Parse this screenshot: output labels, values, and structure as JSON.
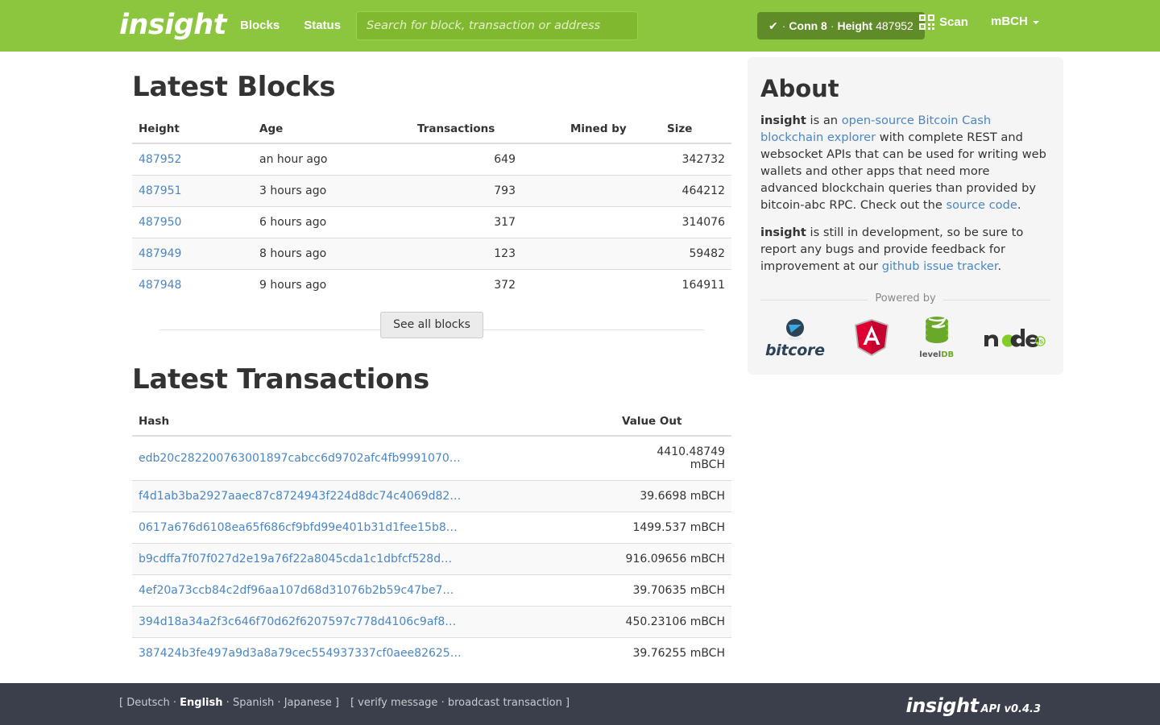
{
  "navbar": {
    "brand": "insight",
    "links": [
      {
        "label": "Blocks",
        "name": "nav-link-blocks"
      },
      {
        "label": "Status",
        "name": "nav-link-status"
      }
    ],
    "search": {
      "placeholder": "Search for block, transaction or address",
      "value": ""
    },
    "status": {
      "check": "✔",
      "separator": "·",
      "conn_label": "Conn 8",
      "height_label": "Height",
      "height_value": "487952"
    },
    "scan_label": "Scan",
    "currency_label": "mBCH",
    "accent_color": "#8cc63f",
    "badge_color": "#5f8b28"
  },
  "blocks_section": {
    "title": "Latest Blocks",
    "columns": [
      "Height",
      "Age",
      "Transactions",
      "Mined by",
      "Size"
    ],
    "rows": [
      {
        "height": "487952",
        "age": "an hour ago",
        "transactions": "649",
        "mined_by": "",
        "size": "342732"
      },
      {
        "height": "487951",
        "age": "3 hours ago",
        "transactions": "793",
        "mined_by": "",
        "size": "464212"
      },
      {
        "height": "487950",
        "age": "6 hours ago",
        "transactions": "317",
        "mined_by": "",
        "size": "314076"
      },
      {
        "height": "487949",
        "age": "8 hours ago",
        "transactions": "123",
        "mined_by": "",
        "size": "59482"
      },
      {
        "height": "487948",
        "age": "9 hours ago",
        "transactions": "372",
        "mined_by": "",
        "size": "164911"
      }
    ],
    "see_all_label": "See all blocks"
  },
  "transactions_section": {
    "title": "Latest Transactions",
    "columns": [
      "Hash",
      "Value Out"
    ],
    "rows": [
      {
        "hash": "edb20c282200763001897cabcc6d9702afc4fb9991070…",
        "value_out": "4410.48749 mBCH"
      },
      {
        "hash": "f4d1ab3ba2927aaec87c8724943f224d8dc74c4069d82…",
        "value_out": "39.6698 mBCH"
      },
      {
        "hash": "0617a676d6108ea65f686cf9bfd99e401b31d1fee15b8…",
        "value_out": "1499.537 mBCH"
      },
      {
        "hash": "b9cdffa7f07f027d2e19a76f22a8045cda1c1dbfcf528d…",
        "value_out": "916.09656 mBCH"
      },
      {
        "hash": "4ef20a73ccb84c2df96aa107d68d31076b2b59c47be7…",
        "value_out": "39.70635 mBCH"
      },
      {
        "hash": "394d18a34a2f3c646f70d62f6207597c778d4106c9af8…",
        "value_out": "450.23106 mBCH"
      },
      {
        "hash": "387424b3fe497a9d3a8a79cec554937337cf0aee82625…",
        "value_out": "39.76255 mBCH"
      }
    ]
  },
  "about": {
    "title": "About",
    "p1": {
      "brand": "insight",
      "t1": " is an ",
      "link1": "open-source Bitcoin Cash blockchain explorer",
      "t2": " with complete REST and websocket APIs that can be used for writing web wallets and other apps that need more advanced blockchain queries than provided by bitcoin-abc RPC. Check out the ",
      "link2": "source code",
      "t3": "."
    },
    "p2": {
      "brand": "insight",
      "t1": " is still in development, so be sure to report any bugs and provide feedback for improvement at our ",
      "link1": "github issue tracker",
      "t2": "."
    },
    "powered_by_label": "Powered by",
    "logos": [
      {
        "name": "bitcore-logo",
        "text": "bitcore"
      },
      {
        "name": "angular-logo",
        "text": "A"
      },
      {
        "name": "leveldb-logo",
        "text_a": "level",
        "text_b": "DB"
      },
      {
        "name": "nodejs-logo",
        "text": "node"
      }
    ]
  },
  "footer": {
    "languages": [
      {
        "label": "Deutsch",
        "active": false
      },
      {
        "label": "English",
        "active": true
      },
      {
        "label": "Spanish",
        "active": false
      },
      {
        "label": "Japanese",
        "active": false
      }
    ],
    "tools": [
      {
        "label": "verify message"
      },
      {
        "label": "broadcast transaction"
      }
    ],
    "open_bracket": "[",
    "close_bracket": "]",
    "dot": "·",
    "brand": "insight",
    "version": "API v0.4.3",
    "background": "#3a3f4b"
  }
}
